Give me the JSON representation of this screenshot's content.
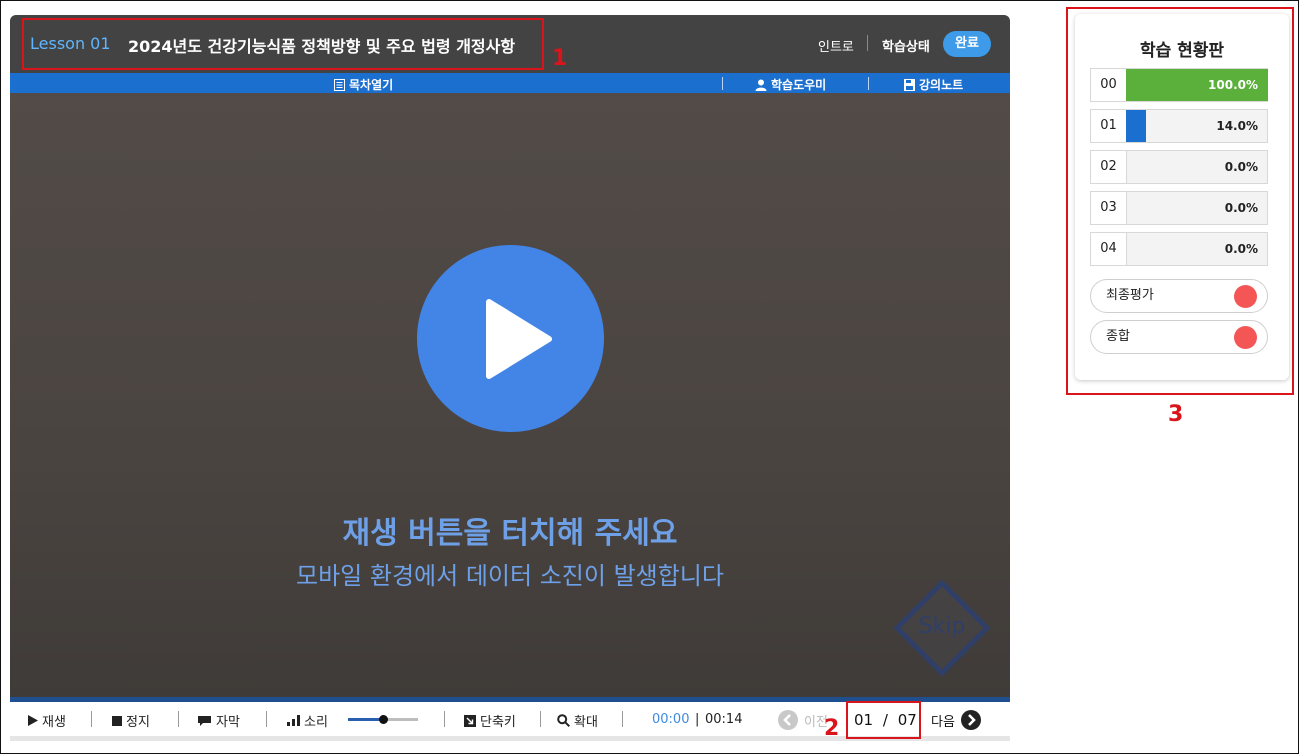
{
  "header": {
    "lesson_number": "Lesson 01",
    "lesson_title": "2024년도 건강기능식품 정책방향 및 주요 법령 개정사항",
    "intro": "인트로",
    "status_label": "학습상태",
    "status_badge": "완료"
  },
  "toolbar": {
    "toc": "목차열기",
    "helper": "학습도우미",
    "notes": "강의노트"
  },
  "video": {
    "touch_message": "재생 버튼을 터치해 주세요",
    "data_message": "모바일 환경에서 데이터 소진이 발생합니다",
    "skip_label": "Skip"
  },
  "controls": {
    "play": "재생",
    "stop": "정지",
    "subtitle": "자막",
    "volume": "소리",
    "volume_level": 0.5,
    "shortcut": "단축키",
    "zoom": "확대",
    "time_current": "00:00",
    "time_separator": "|",
    "time_total": "00:14",
    "prev": "이전",
    "page_current": "01",
    "page_separator": "/",
    "page_total": "07",
    "next": "다음"
  },
  "annotations": [
    "1",
    "2",
    "3"
  ],
  "status_panel": {
    "title": "학습 현황판",
    "rows": [
      {
        "num": "00",
        "value": "100.0%",
        "fraction": 1.0,
        "color": "#5ab03a"
      },
      {
        "num": "01",
        "value": "14.0%",
        "fraction": 0.14,
        "color": "#1b6fcf"
      },
      {
        "num": "02",
        "value": "0.0%",
        "fraction": 0.0,
        "color": "#1b6fcf"
      },
      {
        "num": "03",
        "value": "0.0%",
        "fraction": 0.0,
        "color": "#1b6fcf"
      },
      {
        "num": "04",
        "value": "0.0%",
        "fraction": 0.0,
        "color": "#1b6fcf"
      }
    ],
    "final_eval": "최종평가",
    "overall": "종합",
    "indicator_color": "#f45656"
  }
}
